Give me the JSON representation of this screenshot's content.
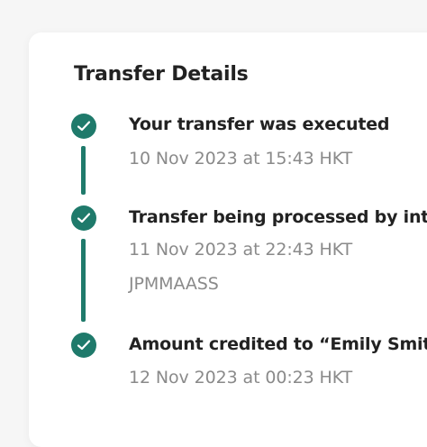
{
  "title": "Transfer Details",
  "accent_color": "#1f7a6b",
  "steps": [
    {
      "icon": "check-icon",
      "title": "Your transfer was executed",
      "timestamp": "10 Nov 2023 at 15:43 HKT"
    },
    {
      "icon": "check-icon",
      "title": "Transfer being processed by inte",
      "timestamp": "11 Nov 2023 at 22:43 HKT",
      "reference": "JPMMAASS"
    },
    {
      "icon": "check-icon",
      "title": "Amount credited to “Emily Smith",
      "timestamp": "12 Nov 2023 at 00:23 HKT"
    }
  ]
}
